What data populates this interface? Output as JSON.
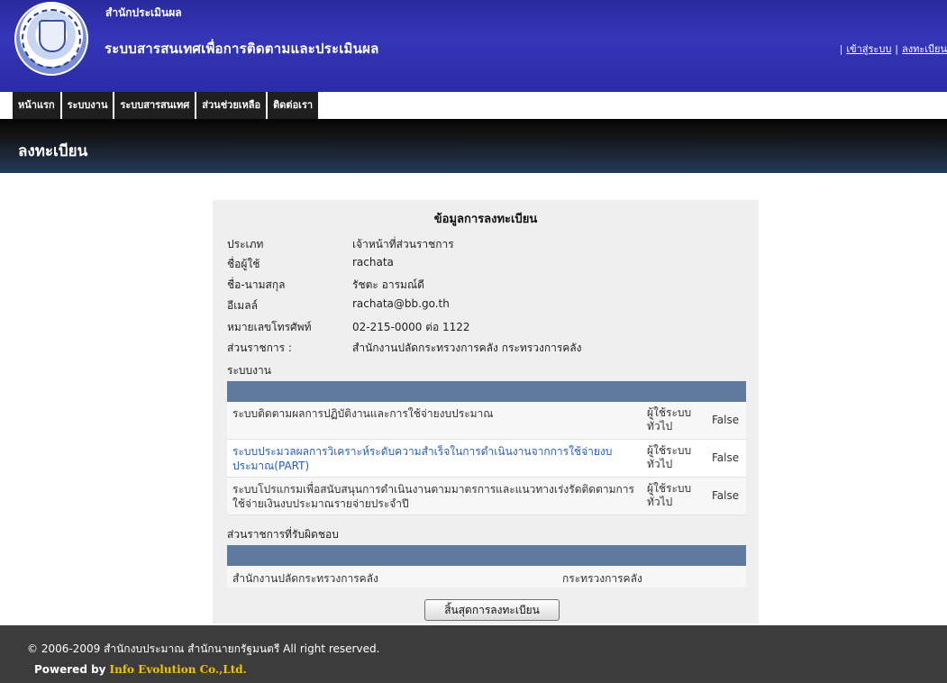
{
  "header": {
    "org_name": "สำนักประเมินผล",
    "system_title": "ระบบสารสนเทศเพื่อการติดตามและประเมินผล",
    "login_link": "เข้าสู่ระบบ",
    "register_link": "ลงทะเบียน",
    "separator": "|",
    "logo_icon": "agency-seal-logo"
  },
  "nav": {
    "items": [
      {
        "label": "หน้าแรก"
      },
      {
        "label": "ระบบงาน"
      },
      {
        "label": "ระบบสารสนเทศ"
      },
      {
        "label": "ส่วนช่วยเหลือ"
      },
      {
        "label": "ติดต่อเรา"
      }
    ]
  },
  "page": {
    "title": "ลงทะเบียน"
  },
  "form": {
    "title": "ข้อมูลการลงทะเบียน",
    "fields": [
      {
        "label": "ประเภท",
        "value": "เจ้าหน้าที่ส่วนราชการ"
      },
      {
        "label": "ชื่อผู้ใช้",
        "value": "rachata"
      },
      {
        "label": "ชื่อ-นามสกุล",
        "value": "รัชตะ อารมณ์ดี"
      },
      {
        "label": "อีเมลล์",
        "value": "rachata@bb.go.th"
      },
      {
        "label": "หมายเลขโทรศัพท์",
        "value": "02-215-0000 ต่อ 1122"
      },
      {
        "label": "ส่วนราชการ :",
        "value": "สำนักงานปลัดกระทรวงการคลัง กระทรวงการคลัง"
      }
    ],
    "systems_label": "ระบบงาน",
    "systems": [
      {
        "name": "ระบบติดตามผลการปฏิบัติงานและการใช้จ่ายงบประมาณ",
        "role": "ผู้ใช้ระบบทั่วไป",
        "flag": "False"
      },
      {
        "name": "ระบบประมวลผลการวิเคราะห์ระดับความสำเร็จในการดำเนินงานจากการใช้จ่ายงบประมาณ(PART)",
        "role": "ผู้ใช้ระบบทั่วไป",
        "flag": "False"
      },
      {
        "name": "ระบบโปรแกรมเพื่อสนับสนุนการดำเนินงานตามมาตรการและแนวทางเร่งรัดติดตามการใช้จ่ายเงินงบประมาณรายจ่ายประจำปี",
        "role": "ผู้ใช้ระบบทั่วไป",
        "flag": "False"
      }
    ],
    "departments_label": "ส่วนราชการที่รับผิดชอบ",
    "departments": [
      {
        "name": "สำนักงานปลัดกระทรวงการคลัง",
        "ministry": "กระทรวงการคลัง"
      }
    ],
    "finish_button": "สิ้นสุดการลงทะเบียน"
  },
  "footer": {
    "copyright": "© 2006-2009 สำนักงบประมาณ สำนักนายกรัฐมนตรี All right reserved.",
    "powered_by": "Powered by",
    "company": "Info Evolution Co.,Ltd."
  },
  "colors": {
    "header_blue": "#3535b8",
    "nav_dark": "#1f1f1f",
    "table_header": "#5e7b9e",
    "link_blue": "#2a5cb8",
    "company_gold": "#f2c200"
  }
}
